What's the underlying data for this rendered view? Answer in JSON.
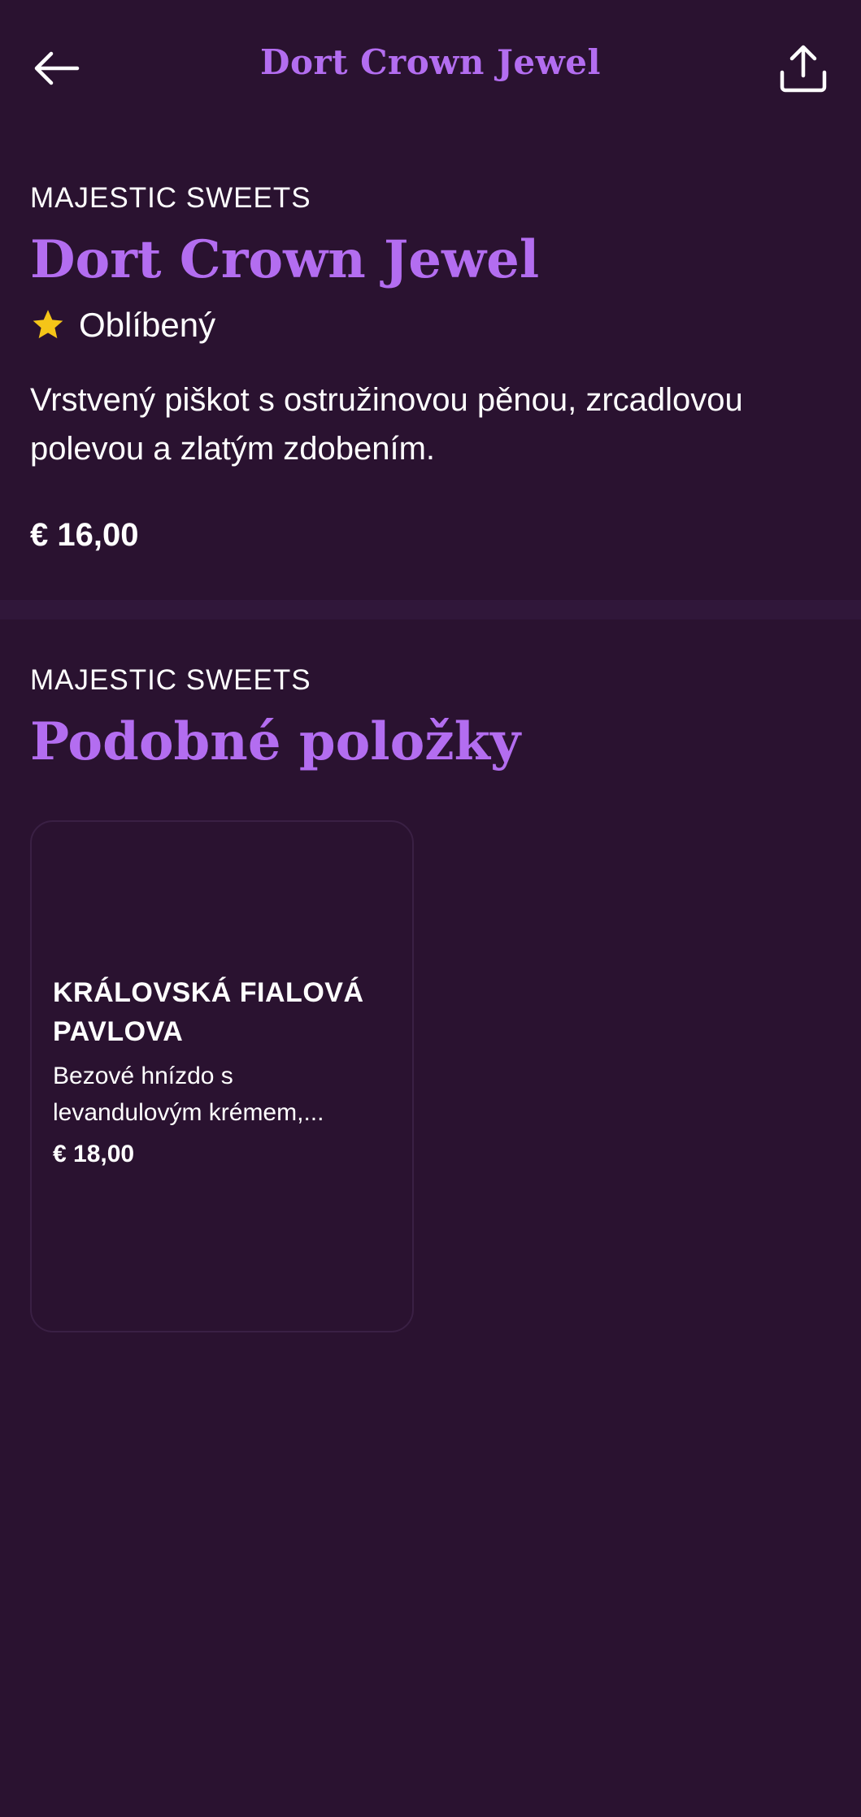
{
  "header": {
    "title": "Dort Crown Jewel"
  },
  "product": {
    "brand": "MAJESTIC SWEETS",
    "name": "Dort Crown Jewel",
    "badge": "Oblíbený",
    "description": "Vrstvený piškot s ostružinovou pěnou, zrcadlovou polevou a zlatým zdobením.",
    "price": "€ 16,00"
  },
  "similar": {
    "brand": "MAJESTIC SWEETS",
    "title": "Podobné položky",
    "items": [
      {
        "name": "KRÁLOVSKÁ FIALOVÁ PAVLOVA",
        "description": "Bezové hnízdo s levandulovým krémem,...",
        "price": "€ 18,00"
      }
    ]
  },
  "icons": {
    "back": "arrow-left-icon",
    "share": "share-icon",
    "badge": "star-icon"
  },
  "colors": {
    "background": "#2a1230",
    "accent": "#b36df0",
    "star": "#f5c518"
  }
}
